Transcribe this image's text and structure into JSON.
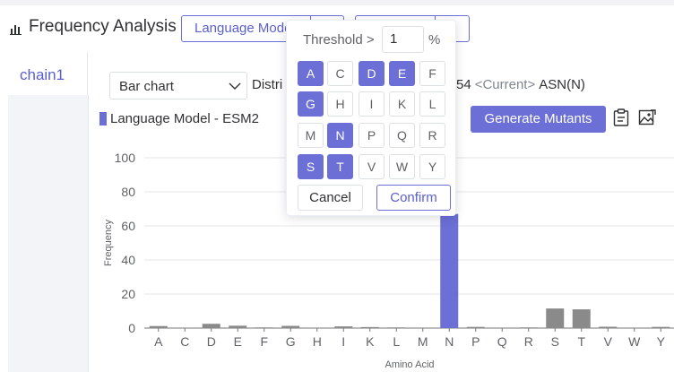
{
  "header": {
    "title": "Frequency Analysis",
    "model_button_label": "Language Model - ESM2"
  },
  "sidebar": {
    "tabs": [
      {
        "label": "chain1"
      }
    ]
  },
  "controls": {
    "chart_type_selected": "Bar chart",
    "distribution_text": "Distri",
    "residue_position": "54",
    "residue_current": "<Current>",
    "residue_name": "ASN(N)",
    "legend_label": "Language Model - ESM2",
    "generate_button_label": "Generate Mutants"
  },
  "popover": {
    "threshold_label": "Threshold >",
    "threshold_value": "1",
    "threshold_unit": "%",
    "amino_acids": [
      {
        "letter": "A",
        "selected": true
      },
      {
        "letter": "C",
        "selected": false
      },
      {
        "letter": "D",
        "selected": true
      },
      {
        "letter": "E",
        "selected": true
      },
      {
        "letter": "F",
        "selected": false
      },
      {
        "letter": "G",
        "selected": true
      },
      {
        "letter": "H",
        "selected": false
      },
      {
        "letter": "I",
        "selected": false
      },
      {
        "letter": "K",
        "selected": false
      },
      {
        "letter": "L",
        "selected": false
      },
      {
        "letter": "M",
        "selected": false
      },
      {
        "letter": "N",
        "selected": true
      },
      {
        "letter": "P",
        "selected": false
      },
      {
        "letter": "Q",
        "selected": false
      },
      {
        "letter": "R",
        "selected": false
      },
      {
        "letter": "S",
        "selected": true
      },
      {
        "letter": "T",
        "selected": true
      },
      {
        "letter": "V",
        "selected": false
      },
      {
        "letter": "W",
        "selected": false
      },
      {
        "letter": "Y",
        "selected": false
      }
    ],
    "cancel_label": "Cancel",
    "confirm_label": "Confirm"
  },
  "colors": {
    "accent": "#6b6fd6",
    "bar_other": "#8a8a8a",
    "bar_current": "#6b6fd6"
  },
  "chart_data": {
    "type": "bar",
    "xlabel": "Amino Acid",
    "ylabel": "Frequency",
    "ylim": [
      0,
      100
    ],
    "yticks": [
      0,
      20,
      40,
      60,
      80,
      100
    ],
    "grid": true,
    "categories": [
      "A",
      "C",
      "D",
      "E",
      "F",
      "G",
      "H",
      "I",
      "K",
      "L",
      "M",
      "N",
      "P",
      "Q",
      "R",
      "S",
      "T",
      "V",
      "W",
      "Y"
    ],
    "values": [
      1.2,
      0.3,
      2.5,
      1.4,
      0.4,
      1.3,
      0.3,
      1.0,
      0.6,
      0.4,
      0.3,
      67,
      0.7,
      0.3,
      0.4,
      11.5,
      11,
      0.8,
      0.3,
      0.7
    ],
    "highlight": "N"
  }
}
